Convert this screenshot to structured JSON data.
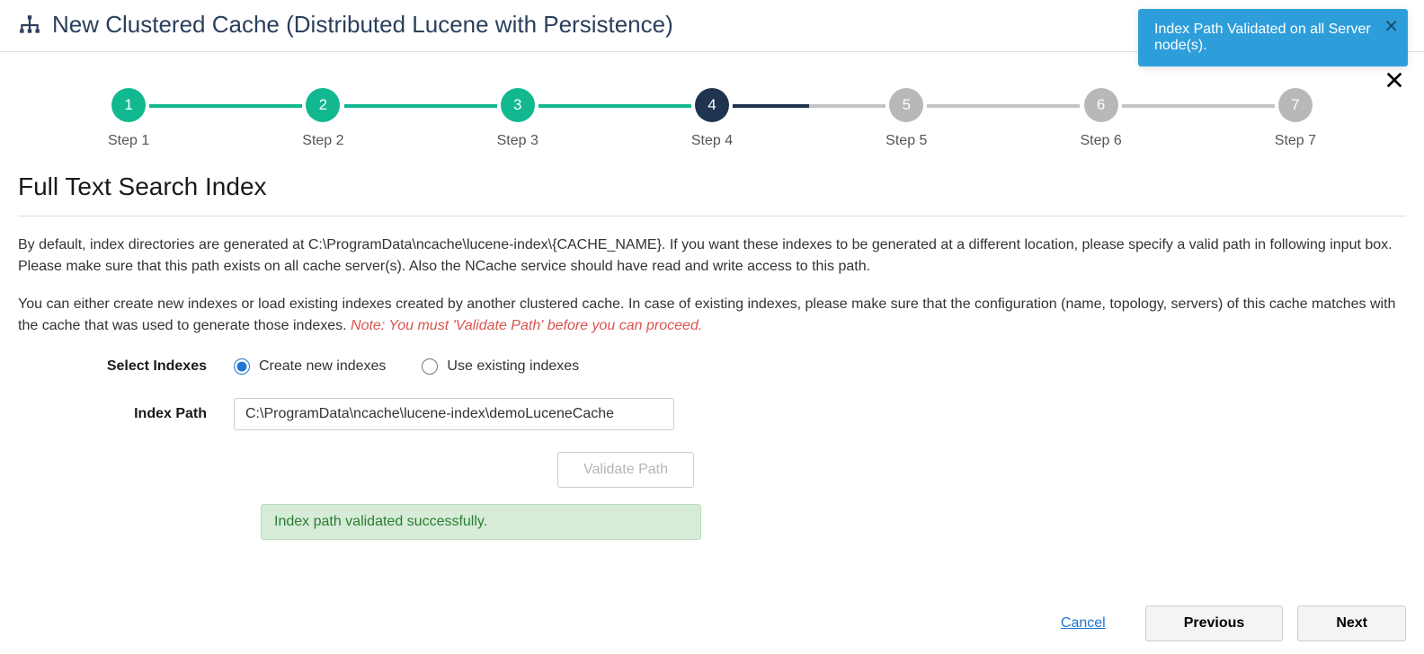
{
  "header": {
    "title": "New Clustered Cache (Distributed Lucene with Persistence)"
  },
  "toast": {
    "message": "Index Path Validated on all Server node(s)."
  },
  "wizard": {
    "steps": [
      {
        "num": "1",
        "label": "Step 1",
        "status": "completed"
      },
      {
        "num": "2",
        "label": "Step 2",
        "status": "completed"
      },
      {
        "num": "3",
        "label": "Step 3",
        "status": "completed"
      },
      {
        "num": "4",
        "label": "Step 4",
        "status": "active"
      },
      {
        "num": "5",
        "label": "Step 5",
        "status": "pending"
      },
      {
        "num": "6",
        "label": "Step 6",
        "status": "pending"
      },
      {
        "num": "7",
        "label": "Step 7",
        "status": "pending"
      }
    ]
  },
  "section": {
    "heading": "Full Text Search Index",
    "desc1": "By default, index directories are generated at C:\\ProgramData\\ncache\\lucene-index\\{CACHE_NAME}. If you want these indexes to be generated at a different location, please specify a valid path in following input box. Please make sure that this path exists on all cache server(s). Also the NCache service should have read and write access to this path.",
    "desc2_pre": "You can either create new indexes or load existing indexes created by another clustered cache. In case of existing indexes, please make sure that the configuration (name, topology, servers) of this cache matches with the cache that was used to generate those indexes. ",
    "desc2_note": "Note: You must 'Validate Path' before you can proceed."
  },
  "form": {
    "select_indexes_label": "Select Indexes",
    "create_new_label": "Create new indexes",
    "use_existing_label": "Use existing indexes",
    "index_path_label": "Index Path",
    "index_path_value": "C:\\ProgramData\\ncache\\lucene-index\\demoLuceneCache",
    "validate_button": "Validate Path",
    "success_message": "Index path validated successfully."
  },
  "footer": {
    "cancel": "Cancel",
    "previous": "Previous",
    "next": "Next"
  }
}
